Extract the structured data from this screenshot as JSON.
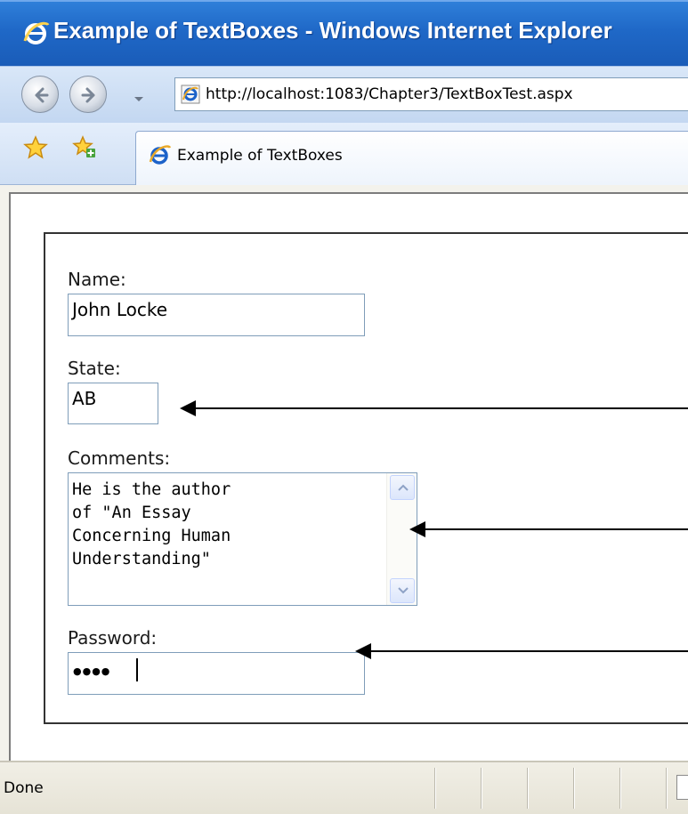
{
  "window": {
    "title": "Example of TextBoxes - Windows Internet Explorer"
  },
  "address_bar": {
    "url": "http://localhost:1083/Chapter3/TextBoxTest.aspx"
  },
  "tab": {
    "label": "Example of TextBoxes"
  },
  "form": {
    "name_label": "Name:",
    "name_value": "John Locke",
    "state_label": "State:",
    "state_value": "AB",
    "comments_label": "Comments:",
    "comments_value": "He is the author\nof \"An Essay\nConcerning Human\nUnderstanding\"",
    "password_label": "Password:",
    "password_masked": "●●●●"
  },
  "status_bar": {
    "text": "Done"
  },
  "icons": {
    "browser_logo": "ie-logo-icon",
    "back": "back-arrow-icon",
    "forward": "forward-arrow-icon",
    "favorites": "favorites-star-icon",
    "add_favorites": "add-favorites-icon",
    "scroll_up": "chevron-up-icon",
    "scroll_down": "chevron-down-icon"
  },
  "colors": {
    "titlebar": "#1f68c7",
    "title_text": "#ffffff",
    "field_border": "#7f9db9",
    "status_bar": "#ece9d8"
  }
}
